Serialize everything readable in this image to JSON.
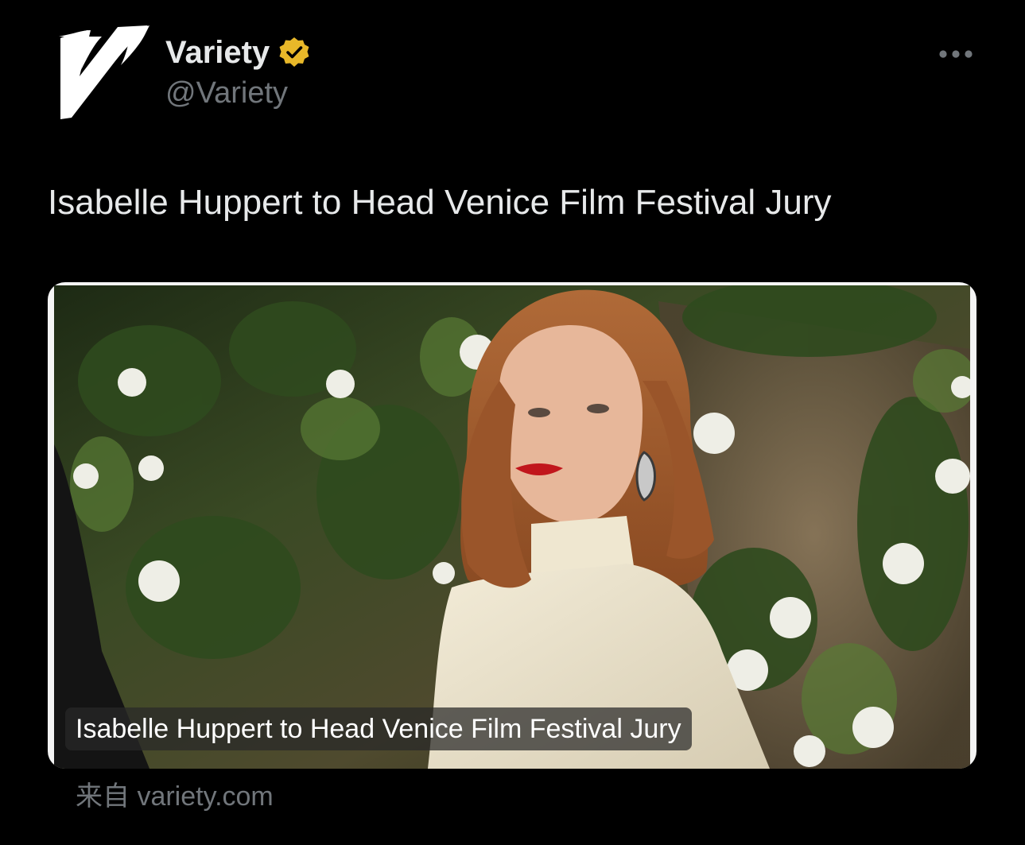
{
  "author": {
    "display_name": "Variety",
    "handle": "@Variety",
    "avatar_icon": "variety-v-logo",
    "verified_icon": "verified-badge-icon",
    "verified_color": "#e8b829"
  },
  "tweet": {
    "text": "Isabelle Huppert to Head Venice Film Festival Jury"
  },
  "link_card": {
    "title": "Isabelle Huppert to Head Venice Film Festival Jury",
    "source": "来自 variety.com"
  },
  "icons": {
    "more": "more-horizontal-icon"
  },
  "colors": {
    "background": "#000000",
    "primary_text": "#e7e9ea",
    "secondary_text": "#71767b"
  }
}
